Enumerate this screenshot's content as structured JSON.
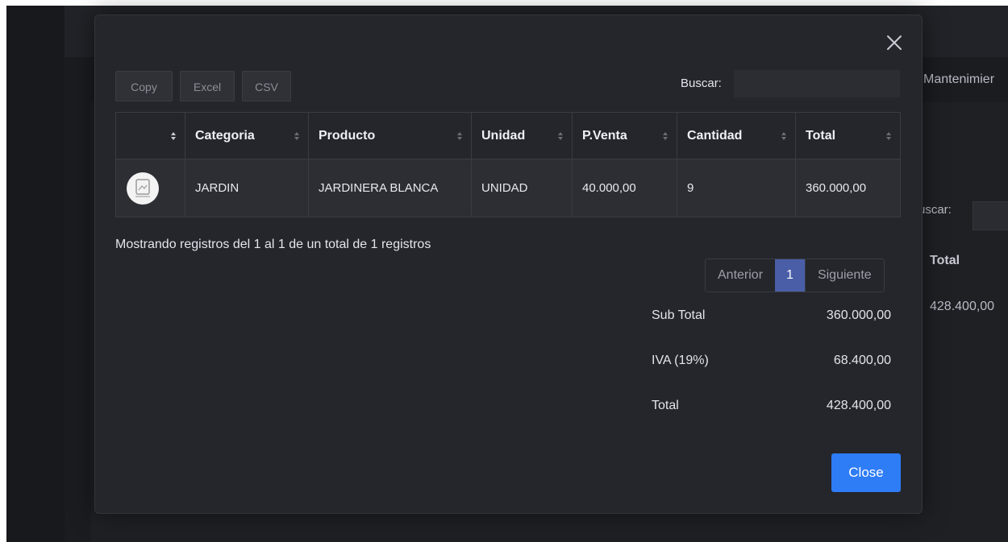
{
  "background": {
    "nav_partial": "Mantenimier",
    "search_partial": "uscar:",
    "total_header": "Total",
    "total_value": "428.400,00"
  },
  "modal": {
    "export_buttons": [
      "Copy",
      "Excel",
      "CSV"
    ],
    "search": {
      "label": "Buscar:",
      "value": ""
    },
    "table": {
      "columns": [
        "",
        "Categoria",
        "Producto",
        "Unidad",
        "P.Venta",
        "Cantidad",
        "Total"
      ],
      "rows": [
        {
          "image": "product-thumbnail",
          "categoria": "JARDIN",
          "producto": "JARDINERA BLANCA",
          "unidad": "UNIDAD",
          "pventa": "40.000,00",
          "cantidad": "9",
          "total": "360.000,00"
        }
      ]
    },
    "info_text": "Mostrando registros del 1 al 1 de un total de 1 registros",
    "pagination": {
      "previous": "Anterior",
      "current": "1",
      "next": "Siguiente"
    },
    "totals": [
      {
        "label": "Sub Total",
        "value": "360.000,00"
      },
      {
        "label": "IVA (19%)",
        "value": "68.400,00"
      },
      {
        "label": "Total",
        "value": "428.400,00"
      }
    ],
    "close_label": "Close"
  },
  "colors": {
    "overlay_bg": "#1b1c20",
    "modal_bg": "#25262b",
    "row_bg": "#2c2e33",
    "active_page": "#4a5ea8",
    "primary_button": "#2e7cf6"
  }
}
